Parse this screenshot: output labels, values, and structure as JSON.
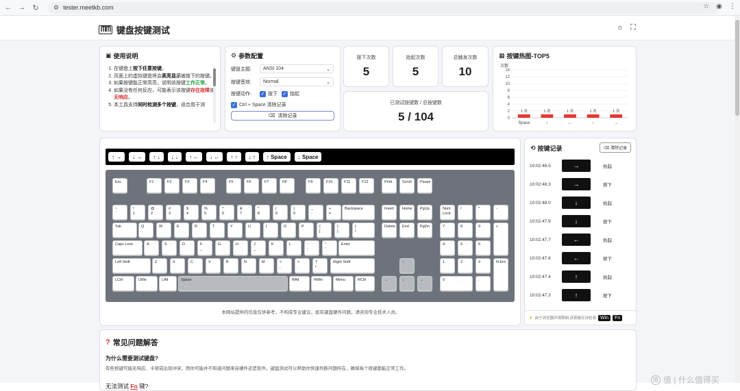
{
  "browser": {
    "url": "tester.meetkb.com"
  },
  "header": {
    "brand_mark": "ᗰᗰ",
    "title": "键盘按键测试"
  },
  "guide": {
    "title": "使用说明",
    "steps": [
      {
        "a": "在键盘上",
        "b": "按下任意按键",
        "c": "。"
      },
      {
        "a": "页面上的虚拟键盘将会",
        "b": "高亮显示",
        "c": "被按下的按键。"
      },
      {
        "a": "如果按键能正常高亮，说明该按键",
        "b": "工作正常",
        "c": "。"
      },
      {
        "a": "如果没有任何反应，可能表示该按键",
        "b": "存在故障",
        "c": "或",
        "d": "无响应",
        "e": "。"
      },
      {
        "a": "本工具支持",
        "b": "同时检测多个按键",
        "c": "，适合用于测"
      }
    ]
  },
  "params": {
    "title": "参数配置",
    "theme_label": "键盘主题:",
    "theme_value": "ANSI 104",
    "sound_label": "按键音效:",
    "sound_value": "Normal",
    "action_label": "按键动作:",
    "action_down": "按下",
    "action_up": "抬起",
    "shortcut": "Ctrl + Space 清除记录",
    "clear_button": "清除记录"
  },
  "stats": {
    "press_label": "按下次数",
    "press_value": "5",
    "release_label": "抬起次数",
    "release_value": "5",
    "total_label": "总触发次数",
    "total_value": "10",
    "tested_label": "已测试按键数 / 总按键数",
    "tested_value": "5 / 104"
  },
  "heatmap": {
    "title": "按键热图-TOP5"
  },
  "chart_data": {
    "type": "bar",
    "title": "",
    "ylabel": "次数",
    "ylim": [
      0,
      14
    ],
    "yticks": [
      0,
      2,
      4,
      6,
      8,
      10,
      12,
      14
    ],
    "categories": [
      "Space",
      "↑",
      "←",
      "↓",
      "→"
    ],
    "values": [
      1,
      1,
      1,
      1,
      1
    ],
    "data_labels": [
      "1 次",
      "1 次",
      "1 次",
      "1 次",
      "1 次"
    ],
    "bar_color": "#e53935",
    "grid": true
  },
  "sequence": [
    "↑ →",
    "↓ →",
    "↑ ↓",
    "↓ ↓",
    "↑ ←",
    "↓ ←",
    "↑ ↑",
    "↓ ↑",
    "↑ Space",
    "↓ Space"
  ],
  "keyboard_note": "本网站提供的信息仅供参考，不构成专业建议。如有键盘硬件问题，请咨询专业技术人员。",
  "history": {
    "title": "按键记录",
    "clear_button": "清除记录",
    "rows": [
      {
        "time": "10:02:48.5",
        "key": "→",
        "action": "抬起"
      },
      {
        "time": "10:02:48.3",
        "key": "→",
        "action": "按下"
      },
      {
        "time": "10:02:48.0",
        "key": "↓",
        "action": "抬起"
      },
      {
        "time": "10:02:47.9",
        "key": "↓",
        "action": "按下"
      },
      {
        "time": "10:02:47.7",
        "key": "←",
        "action": "抬起"
      },
      {
        "time": "10:02:47.6",
        "key": "←",
        "action": "按下"
      },
      {
        "time": "10:02:47.4",
        "key": "↑",
        "action": "抬起"
      },
      {
        "time": "10:02:47.3",
        "key": "↑",
        "action": "按下"
      }
    ]
  },
  "warning": {
    "text": "由于浏览器环境限制,该按键无法检测",
    "key1": "Win",
    "key2": "Fn"
  },
  "faq": {
    "title": "常见问题解答",
    "q1": "为什么需要测试键盘?",
    "a1": "有些按键可能无响应、卡顿或出现冲突，而你可能并不知道问题来自硬件还是软件。键盘测试可以帮助你快速判断问题所在，确保每个按键都能正常工作。",
    "q2_pre": "无法测试",
    "q2_key": "Fn",
    "q2_post": "键?"
  },
  "watermark": "值 | 什么值得买",
  "keys": {
    "esc": "Esc",
    "f1": "F1",
    "f2": "F2",
    "f3": "F3",
    "f4": "F4",
    "f5": "F5",
    "f6": "F6",
    "f7": "F7",
    "f8": "F8",
    "f9": "F9",
    "f10": "F10",
    "f11": "F11",
    "f12": "F12",
    "print": "Print",
    "scroll": "Scroll",
    "pause": "Pause",
    "grave": "~\n`",
    "d1": "!\n1",
    "d2": "@\n2",
    "d3": "#\n3",
    "d4": "$\n4",
    "d5": "%\n5",
    "d6": "^\n6",
    "d7": "&\n7",
    "d8": "*\n8",
    "d9": "(\n9",
    "d0": ")\n0",
    "minus": "_\n-",
    "equal": "+\n=",
    "backspace": "Backspace",
    "insert": "Insert",
    "home": "Home",
    "pgup": "PgUp",
    "numlock": "Num\nLock",
    "npdiv": "/",
    "npmul": "*",
    "npsub": "-",
    "tab": "Tab",
    "q": "Q",
    "w": "W",
    "e": "E",
    "r": "R",
    "t": "T",
    "y": "Y",
    "u": "U",
    "i": "I",
    "o": "O",
    "p": "P",
    "lbr": "{\n[",
    "rbr": "}\n]",
    "bsl": "|\n\\",
    "delete": "Delete",
    "end": "End",
    "pgdn": "PgDn",
    "np7": "7",
    "np8": "8",
    "np9": "9",
    "npadd": "+",
    "caps": "Caps Lock",
    "a": "A",
    "s": "S",
    "d": "D",
    "f": "F\n_",
    "g": "G",
    "h": "H",
    "j": "J\n_",
    "k": "K",
    "l": "L",
    "semi": ":\n;",
    "quote": "\"\n'",
    "enter": "Enter",
    "np4": "4",
    "np5": "5",
    "np6": "6",
    "lshift": "Left Shift",
    "z": "Z",
    "x": "X",
    "c": "C",
    "v": "V",
    "b": "B",
    "n": "N",
    "m": "M",
    "comma": "<\n,",
    "period": ">\n.",
    "slash": "?\n/",
    "rshift": "Right Shift",
    "up": "↑",
    "np1": "1",
    "np2": "2",
    "np3": "3",
    "npenter": "N.Ent",
    "lctrl": "LCtrl",
    "lwin": "LWin",
    "lalt": "LAlt",
    "space": "Space",
    "ralt": "RAlt",
    "rwin": "RWin",
    "menu": "Menu",
    "rctrl": "RCtrl",
    "left": "←",
    "down": "↓",
    "right": "→",
    "np0": "0",
    "npdot": "."
  }
}
